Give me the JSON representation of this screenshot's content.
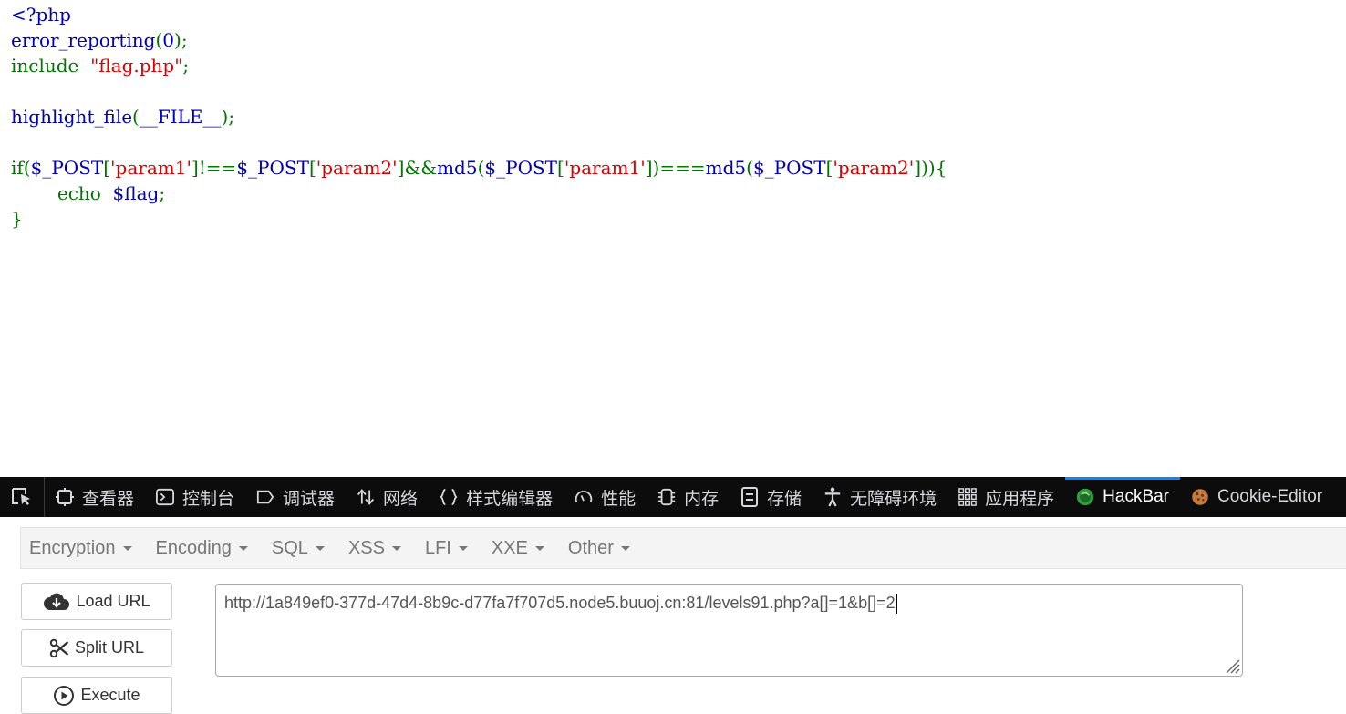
{
  "code": {
    "lines": [
      [
        {
          "t": "<?php",
          "c": "def"
        }
      ],
      [
        {
          "t": "error_reporting",
          "c": "def"
        },
        {
          "t": "(",
          "c": "kw"
        },
        {
          "t": "0",
          "c": "def"
        },
        {
          "t": ");",
          "c": "kw"
        }
      ],
      [
        {
          "t": "include  ",
          "c": "kw"
        },
        {
          "t": "\"flag.php\"",
          "c": "str"
        },
        {
          "t": ";",
          "c": "kw"
        }
      ],
      [],
      [
        {
          "t": "highlight_file",
          "c": "def"
        },
        {
          "t": "(",
          "c": "kw"
        },
        {
          "t": "__FILE__",
          "c": "def"
        },
        {
          "t": ");",
          "c": "kw"
        }
      ],
      [],
      [
        {
          "t": "if(",
          "c": "kw"
        },
        {
          "t": "$_POST",
          "c": "def"
        },
        {
          "t": "[",
          "c": "kw"
        },
        {
          "t": "'param1'",
          "c": "str"
        },
        {
          "t": "]!==",
          "c": "kw"
        },
        {
          "t": "$_POST",
          "c": "def"
        },
        {
          "t": "[",
          "c": "kw"
        },
        {
          "t": "'param2'",
          "c": "str"
        },
        {
          "t": "]&&",
          "c": "kw"
        },
        {
          "t": "md5",
          "c": "def"
        },
        {
          "t": "(",
          "c": "kw"
        },
        {
          "t": "$_POST",
          "c": "def"
        },
        {
          "t": "[",
          "c": "kw"
        },
        {
          "t": "'param1'",
          "c": "str"
        },
        {
          "t": "])===",
          "c": "kw"
        },
        {
          "t": "md5",
          "c": "def"
        },
        {
          "t": "(",
          "c": "kw"
        },
        {
          "t": "$_POST",
          "c": "def"
        },
        {
          "t": "[",
          "c": "kw"
        },
        {
          "t": "'param2'",
          "c": "str"
        },
        {
          "t": "])){",
          "c": "kw"
        }
      ],
      [
        {
          "t": "        echo  ",
          "c": "kw"
        },
        {
          "t": "$flag",
          "c": "def"
        },
        {
          "t": ";",
          "c": "kw"
        }
      ],
      [
        {
          "t": "}",
          "c": "kw"
        }
      ]
    ],
    "colors": {
      "def": "#0000bb",
      "kw": "#007700",
      "str": "#dd0000"
    }
  },
  "devtools": {
    "tabs": [
      {
        "label": "查看器",
        "icon": "inspector-icon"
      },
      {
        "label": "控制台",
        "icon": "console-icon"
      },
      {
        "label": "调试器",
        "icon": "debugger-icon"
      },
      {
        "label": "网络",
        "icon": "network-icon"
      },
      {
        "label": "样式编辑器",
        "icon": "style-editor-icon"
      },
      {
        "label": "性能",
        "icon": "performance-icon"
      },
      {
        "label": "内存",
        "icon": "memory-icon"
      },
      {
        "label": "存储",
        "icon": "storage-icon"
      },
      {
        "label": "无障碍环境",
        "icon": "accessibility-icon"
      },
      {
        "label": "应用程序",
        "icon": "application-icon"
      },
      {
        "label": "HackBar",
        "icon": "hackbar-icon",
        "active": true
      },
      {
        "label": "Cookie-Editor",
        "icon": "cookie-icon"
      }
    ],
    "accent": "#0a84ff"
  },
  "hackbar": {
    "menu": [
      "Encryption",
      "Encoding",
      "SQL",
      "XSS",
      "LFI",
      "XXE",
      "Other"
    ],
    "buttons": {
      "load_url": "Load URL",
      "split_url": "Split URL",
      "execute": "Execute"
    },
    "url_value": "http://1a849ef0-377d-47d4-8b9c-d77fa7f707d5.node5.buuoj.cn:81/levels91.php?a[]=1&b[]=2"
  }
}
